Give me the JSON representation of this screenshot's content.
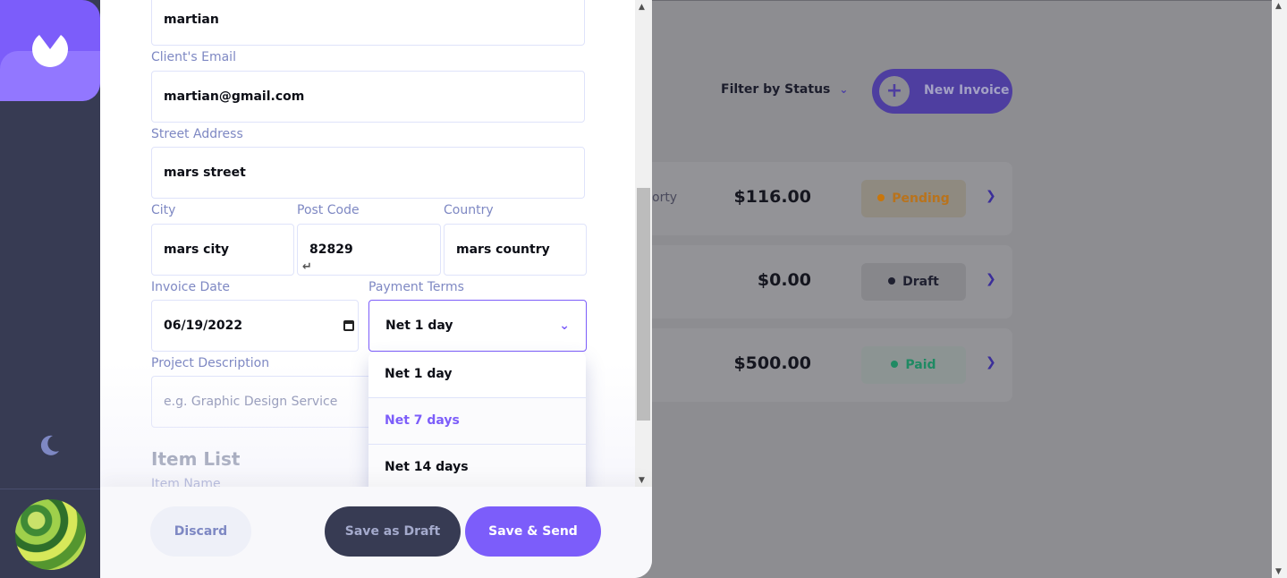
{
  "colors": {
    "accent": "#7c5dfa",
    "sidebar": "#373b53",
    "pending": "#ff8f00",
    "draft": "#373b53",
    "paid": "#33d69f"
  },
  "background": {
    "filter_label": "Filter by Status",
    "new_invoice_label": "New Invoice",
    "invoices": [
      {
        "client": "orty",
        "amount": "$116.00",
        "status": "Pending"
      },
      {
        "client": "",
        "amount": "$0.00",
        "status": "Draft"
      },
      {
        "client": "",
        "amount": "$500.00",
        "status": "Paid"
      }
    ]
  },
  "form": {
    "client_name_value": "martian",
    "client_email_label": "Client's Email",
    "client_email_value": "martian@gmail.com",
    "street_label": "Street Address",
    "street_value": "mars street",
    "city_label": "City",
    "city_value": "mars city",
    "postcode_label": "Post Code",
    "postcode_value": "82829",
    "country_label": "Country",
    "country_value": "mars country",
    "invoice_date_label": "Invoice Date",
    "invoice_date_value": "06/19/2022",
    "payment_terms_label": "Payment Terms",
    "payment_terms_value": "Net 1 day",
    "payment_terms_options": [
      "Net 1 day",
      "Net 7 days",
      "Net 14 days"
    ],
    "project_description_label": "Project Description",
    "project_description_placeholder": "e.g. Graphic Design Service",
    "item_list_title": "Item List",
    "item_name_label": "Item Name"
  },
  "footer": {
    "discard_label": "Discard",
    "save_draft_label": "Save as Draft",
    "save_send_label": "Save & Send"
  }
}
